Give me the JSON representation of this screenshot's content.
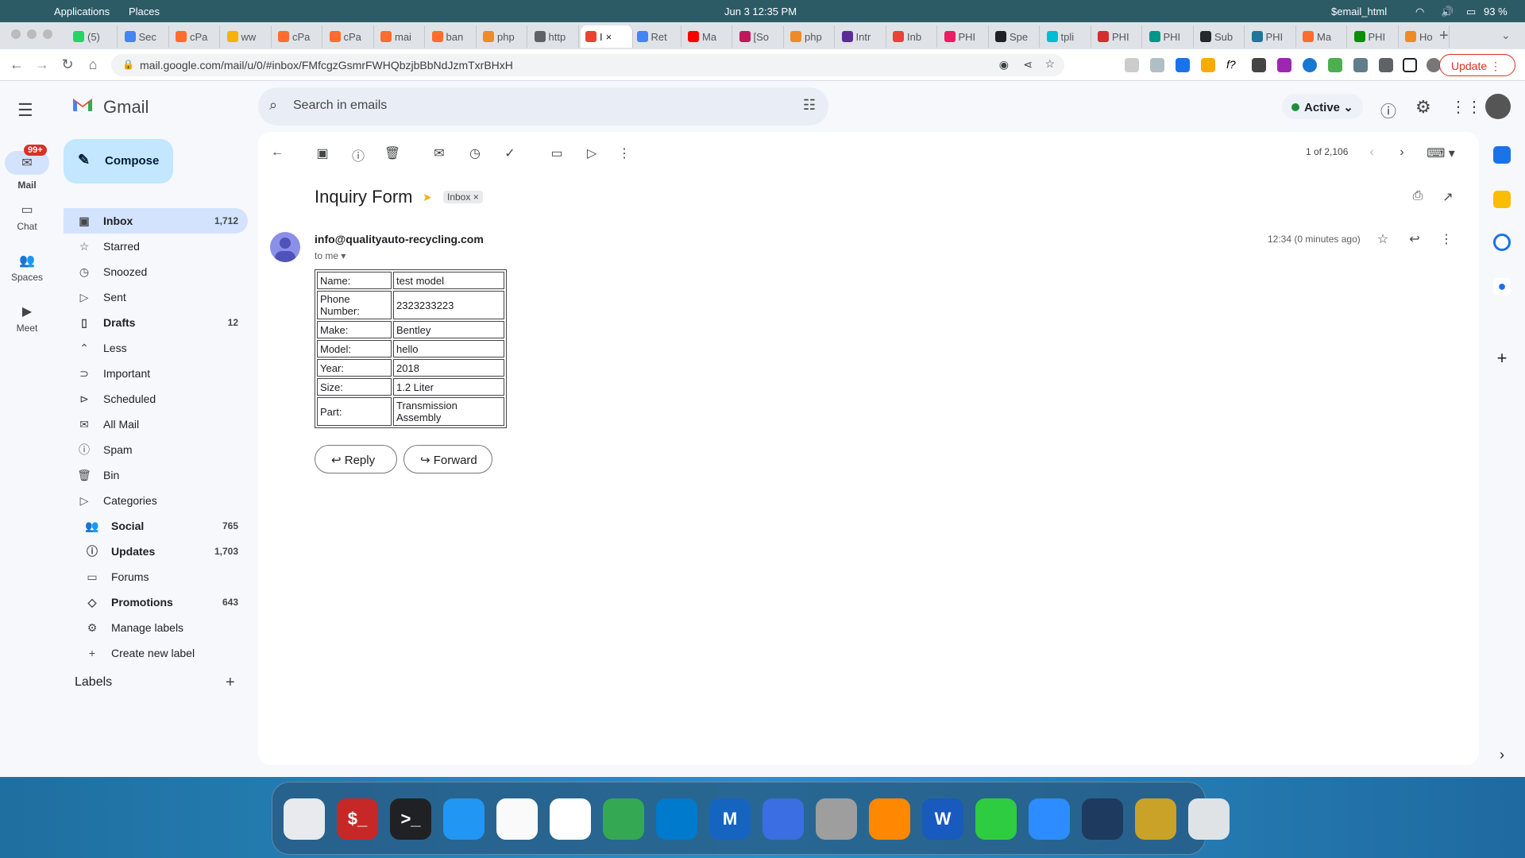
{
  "os_bar": {
    "menu1": "Applications",
    "menu2": "Places",
    "datetime": "Jun 3  12:35 PM",
    "user": "$email_html",
    "battery": "93 %"
  },
  "tabs": [
    {
      "label": "(5)",
      "color": "#25d366"
    },
    {
      "label": "Sec",
      "color": "#4285f4"
    },
    {
      "label": "cPa",
      "color": "#ff6c2c"
    },
    {
      "label": "ww",
      "color": "#f4b400"
    },
    {
      "label": "cPa",
      "color": "#ff6c2c"
    },
    {
      "label": "cPa",
      "color": "#ff6c2c"
    },
    {
      "label": "mai",
      "color": "#ff6c2c"
    },
    {
      "label": "ban",
      "color": "#ff6c2c"
    },
    {
      "label": "php",
      "color": "#f08a24"
    },
    {
      "label": "http",
      "color": "#5f6368"
    },
    {
      "label": "I",
      "color": "#ea4335",
      "active": true
    },
    {
      "label": "Ret",
      "color": "#4285f4"
    },
    {
      "label": "Ma",
      "color": "#ff0000"
    },
    {
      "label": "[So",
      "color": "#c2185b"
    },
    {
      "label": "php",
      "color": "#f08a24"
    },
    {
      "label": "Intr",
      "color": "#5c2d91"
    },
    {
      "label": "Inb",
      "color": "#ea4335"
    },
    {
      "label": "PHI",
      "color": "#e91e63"
    },
    {
      "label": "Spe",
      "color": "#202124"
    },
    {
      "label": "tpli",
      "color": "#00bcd4"
    },
    {
      "label": "PHI",
      "color": "#d32f2f"
    },
    {
      "label": "PHI",
      "color": "#009688"
    },
    {
      "label": "Sub",
      "color": "#24292e"
    },
    {
      "label": "PHI",
      "color": "#21759b"
    },
    {
      "label": "Ma",
      "color": "#ff6c2c"
    },
    {
      "label": "PHI",
      "color": "#0a8f08"
    },
    {
      "label": "Ho",
      "color": "#f08a24"
    }
  ],
  "address": {
    "url": "mail.google.com/mail/u/0/#inbox/FMfcgzGsmrFWHQbzjbBbNdJzmTxrBHxH",
    "update_label": "Update"
  },
  "gmail": {
    "brand": "Gmail",
    "search_placeholder": "Search in emails",
    "status": "Active",
    "rail": {
      "mail": "Mail",
      "chat": "Chat",
      "spaces": "Spaces",
      "meet": "Meet",
      "badge": "99+"
    },
    "compose": "Compose",
    "nav": [
      {
        "label": "Inbox",
        "count": "1,712",
        "icon": "inbox-icon",
        "glyph": "▣",
        "sel": true
      },
      {
        "label": "Starred",
        "count": "",
        "icon": "star-icon",
        "glyph": "☆"
      },
      {
        "label": "Snoozed",
        "count": "",
        "icon": "clock-icon",
        "glyph": "◷"
      },
      {
        "label": "Sent",
        "count": "",
        "icon": "send-icon",
        "glyph": "▷"
      },
      {
        "label": "Drafts",
        "count": "12",
        "icon": "draft-icon",
        "glyph": "▯",
        "bold": true
      },
      {
        "label": "Less",
        "count": "",
        "icon": "chevron-up-icon",
        "glyph": "⌃"
      },
      {
        "label": "Important",
        "count": "",
        "icon": "important-icon",
        "glyph": "⊃"
      },
      {
        "label": "Scheduled",
        "count": "",
        "icon": "scheduled-icon",
        "glyph": "⊳"
      },
      {
        "label": "All Mail",
        "count": "",
        "icon": "all-mail-icon",
        "glyph": "✉"
      },
      {
        "label": "Spam",
        "count": "",
        "icon": "spam-icon",
        "glyph": "ⓘ"
      },
      {
        "label": "Bin",
        "count": "",
        "icon": "trash-icon",
        "glyph": "🗑"
      },
      {
        "label": "Categories",
        "count": "",
        "icon": "label-icon",
        "glyph": "▷"
      },
      {
        "label": "Social",
        "count": "765",
        "icon": "people-icon",
        "glyph": "👥",
        "bold": true,
        "sub": true
      },
      {
        "label": "Updates",
        "count": "1,703",
        "icon": "info-icon",
        "glyph": "ⓘ",
        "bold": true,
        "sub": true
      },
      {
        "label": "Forums",
        "count": "",
        "icon": "forum-icon",
        "glyph": "▭",
        "sub": true
      },
      {
        "label": "Promotions",
        "count": "643",
        "icon": "tag-icon",
        "glyph": "◇",
        "bold": true,
        "sub": true
      },
      {
        "label": "Manage labels",
        "count": "",
        "icon": "gear-icon",
        "glyph": "⚙",
        "sub": true
      },
      {
        "label": "Create new label",
        "count": "",
        "icon": "plus-icon",
        "glyph": "+",
        "sub": true
      }
    ],
    "labels_heading": "Labels",
    "pager": "1 of 2,106",
    "email": {
      "subject": "Inquiry Form",
      "label_chip": "Inbox",
      "sender": "info@qualityauto-recycling.com",
      "to": "to me",
      "time": "12:34 (0 minutes ago)",
      "rows": [
        {
          "key": "Name:",
          "value": "test model"
        },
        {
          "key": "Phone Number:",
          "value": "2323233223"
        },
        {
          "key": "Make:",
          "value": "Bentley"
        },
        {
          "key": "Model:",
          "value": "hello"
        },
        {
          "key": "Year:",
          "value": "2018"
        },
        {
          "key": "Size:",
          "value": "1.2 Liter"
        },
        {
          "key": "Part:",
          "value": "Transmission Assembly"
        }
      ],
      "reply": "Reply",
      "forward": "Forward"
    }
  },
  "dock": [
    {
      "name": "launchpad-icon",
      "color": "#e8eaed",
      "glyph": ""
    },
    {
      "name": "terminal-red-icon",
      "color": "#c62828",
      "glyph": "$_"
    },
    {
      "name": "terminal-icon",
      "color": "#202124",
      "glyph": ">_"
    },
    {
      "name": "finder-icon",
      "color": "#2196f3",
      "glyph": ""
    },
    {
      "name": "textedit-icon",
      "color": "#fafafa",
      "glyph": ""
    },
    {
      "name": "reminders-icon",
      "color": "#ffffff",
      "glyph": ""
    },
    {
      "name": "chrome-icon",
      "color": "#34a853",
      "glyph": ""
    },
    {
      "name": "vscode-icon",
      "color": "#007acc",
      "glyph": ""
    },
    {
      "name": "metasploit-icon",
      "color": "#1565c0",
      "glyph": "M"
    },
    {
      "name": "toggle-icon",
      "color": "#3b6ee0",
      "glyph": ""
    },
    {
      "name": "settings-icon",
      "color": "#9e9e9e",
      "glyph": ""
    },
    {
      "name": "vlc-icon",
      "color": "#ff8800",
      "glyph": ""
    },
    {
      "name": "word-icon",
      "color": "#185abd",
      "glyph": "W"
    },
    {
      "name": "puzzle-icon",
      "color": "#2ecc40",
      "glyph": ""
    },
    {
      "name": "zoom-icon",
      "color": "#2d8cff",
      "glyph": ""
    },
    {
      "name": "kali-icon",
      "color": "#1e3a5f",
      "glyph": ""
    },
    {
      "name": "keychain-icon",
      "color": "#c9a227",
      "glyph": ""
    },
    {
      "name": "trash-dock-icon",
      "color": "#dfe3e6",
      "glyph": ""
    }
  ]
}
